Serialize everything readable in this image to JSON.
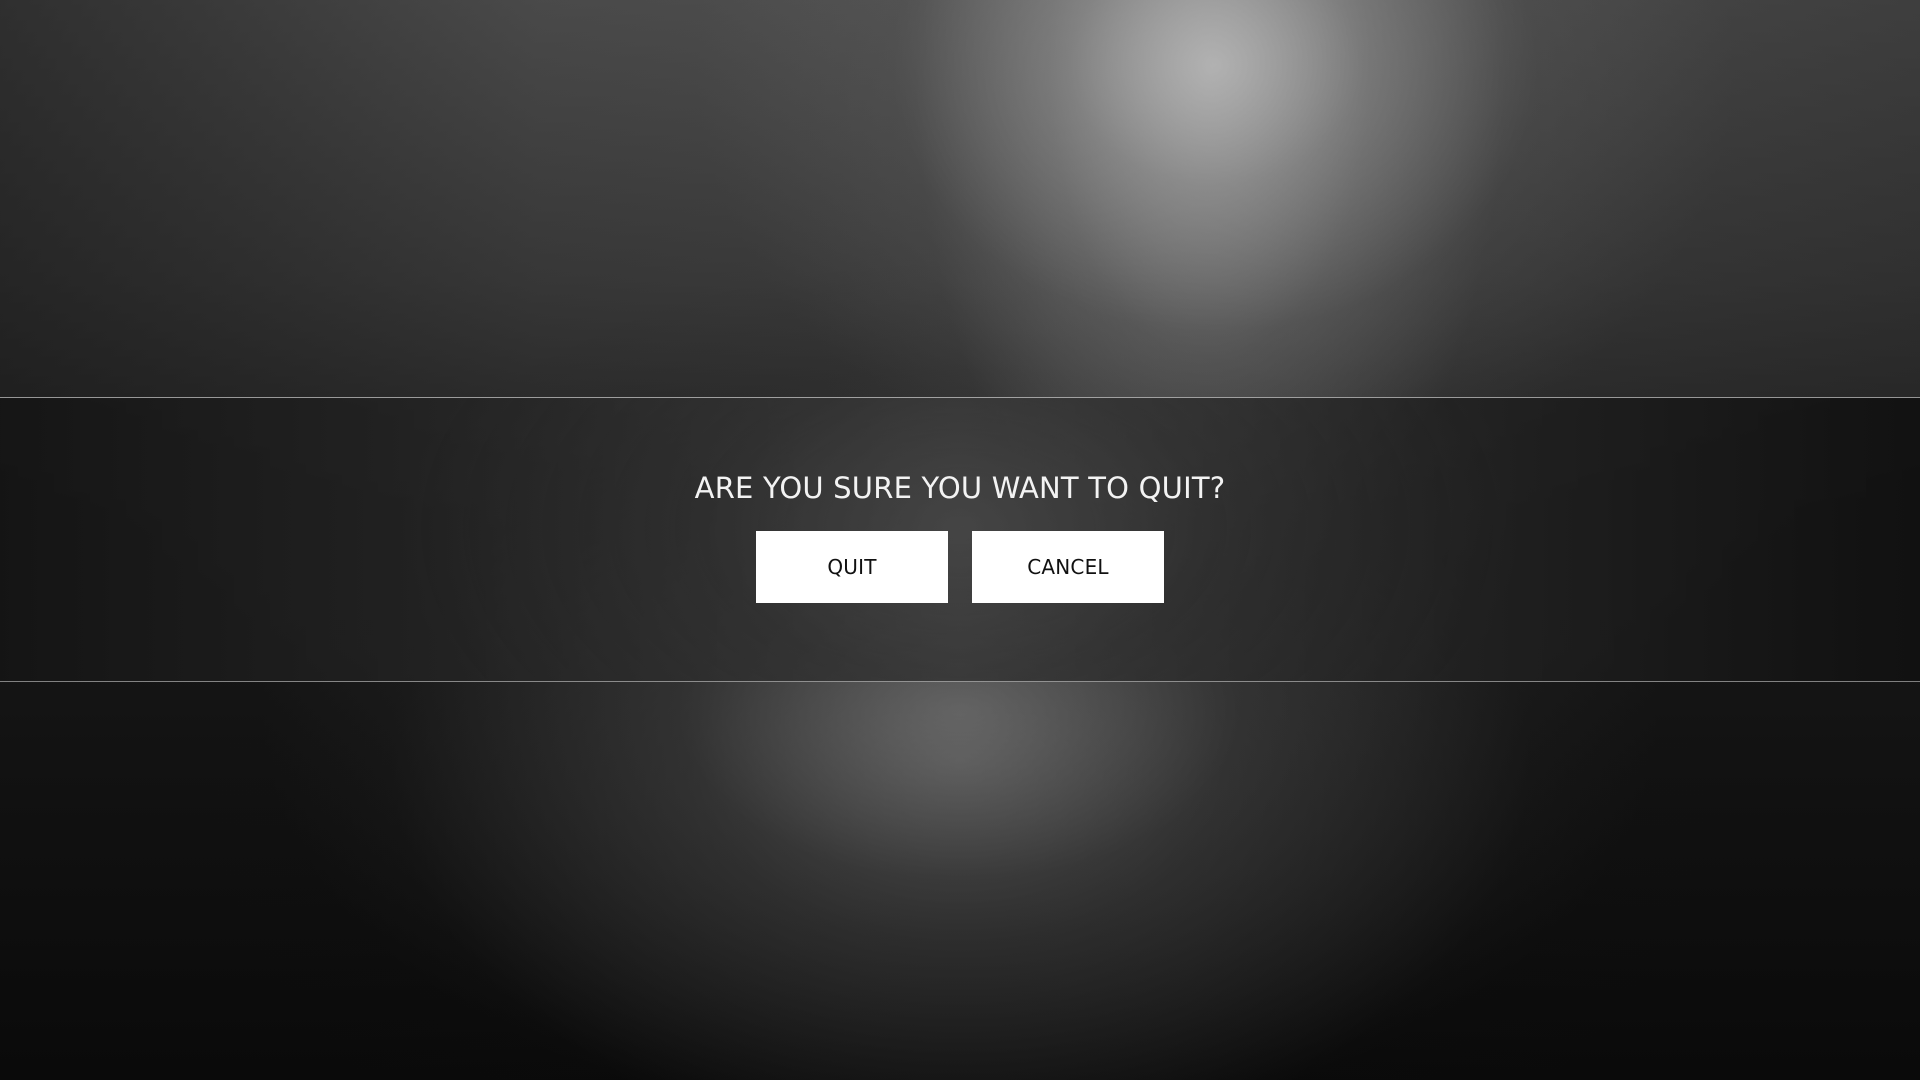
{
  "dialog": {
    "question": "ARE YOU SURE YOU WANT TO QUIT?",
    "quit_label": "QUIT",
    "cancel_label": "CANCEL"
  },
  "colors": {
    "background": "#0c0c0c",
    "button_background": "#ffffff",
    "button_text": "#111111",
    "question_text": "#f3f3f3",
    "divider": "#dcdcdc"
  }
}
